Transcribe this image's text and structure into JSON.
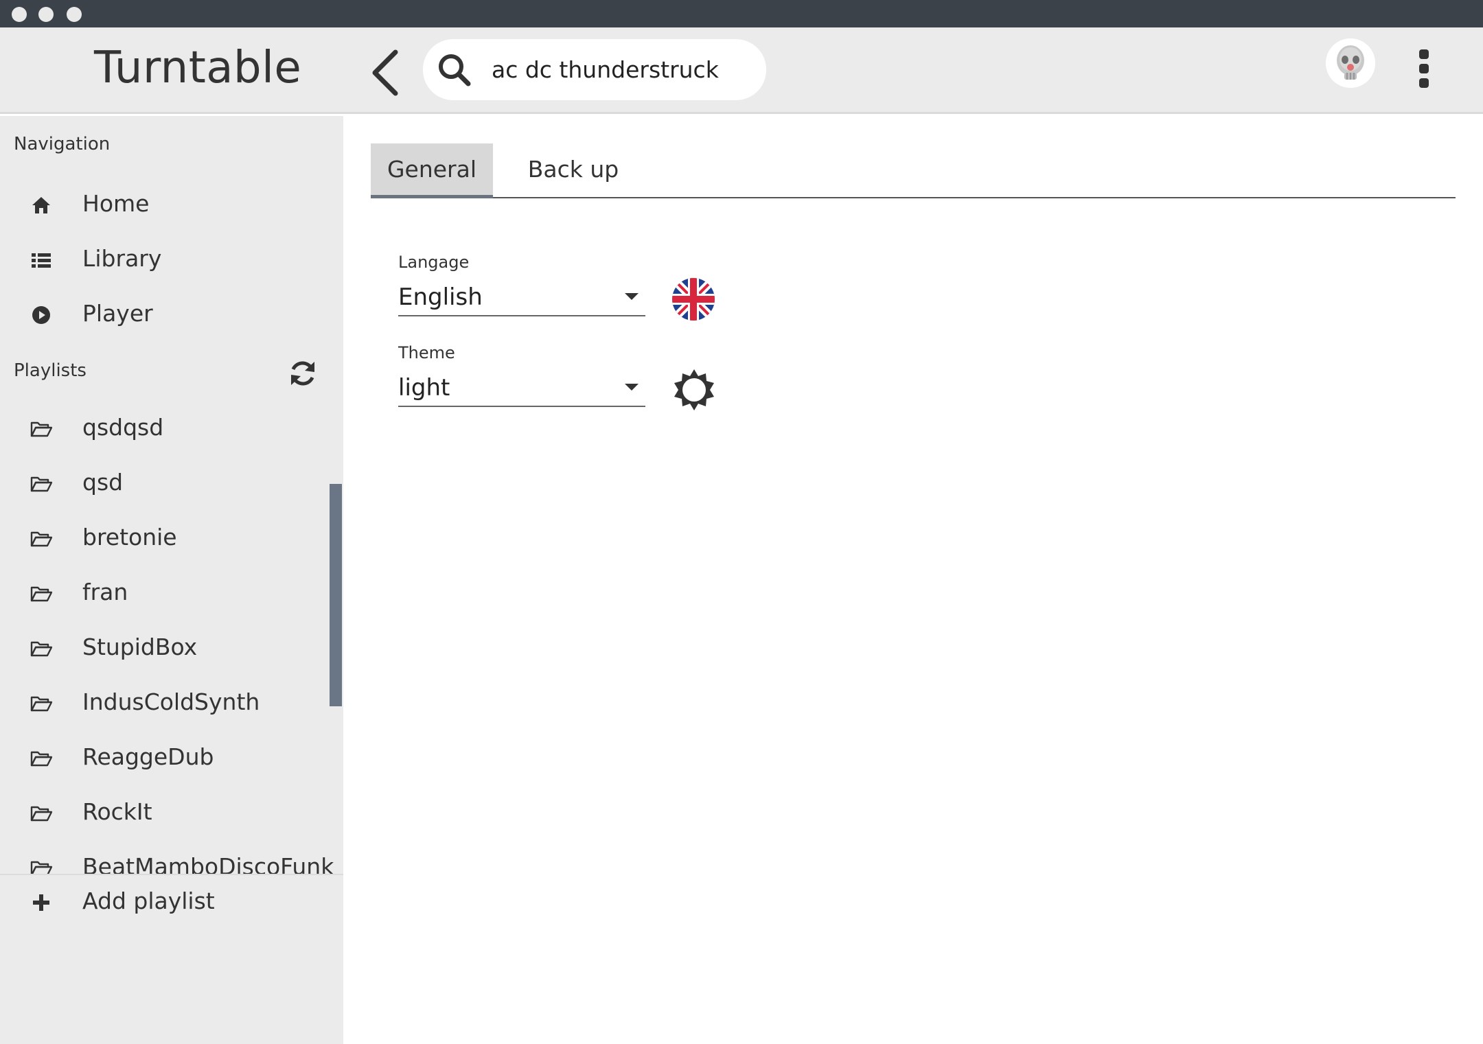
{
  "app": {
    "title": "Turntable"
  },
  "search": {
    "query": "ac dc thunderstruck"
  },
  "sidebar": {
    "navigation_label": "Navigation",
    "nav_items": [
      {
        "label": "Home",
        "icon": "home-icon"
      },
      {
        "label": "Library",
        "icon": "list-icon"
      },
      {
        "label": "Player",
        "icon": "play-circle-icon"
      }
    ],
    "playlists_label": "Playlists",
    "playlists": [
      {
        "label": "qsdqsd"
      },
      {
        "label": "qsd"
      },
      {
        "label": "bretonie"
      },
      {
        "label": "fran"
      },
      {
        "label": "StupidBox"
      },
      {
        "label": "IndusColdSynth"
      },
      {
        "label": "ReaggeDub"
      },
      {
        "label": "RockIt"
      },
      {
        "label": "BeatMamboDiscoFunk"
      }
    ],
    "add_playlist_label": "Add playlist"
  },
  "settings": {
    "tabs": [
      {
        "label": "General",
        "active": true
      },
      {
        "label": "Back up",
        "active": false
      }
    ],
    "language": {
      "label": "Langage",
      "value": "English"
    },
    "theme": {
      "label": "Theme",
      "value": "light"
    }
  },
  "colors": {
    "titlebar": "#3c424a",
    "appbar": "#ebebeb",
    "scrollbar": "#6a7585",
    "active_tab": "#d8d8d8"
  }
}
